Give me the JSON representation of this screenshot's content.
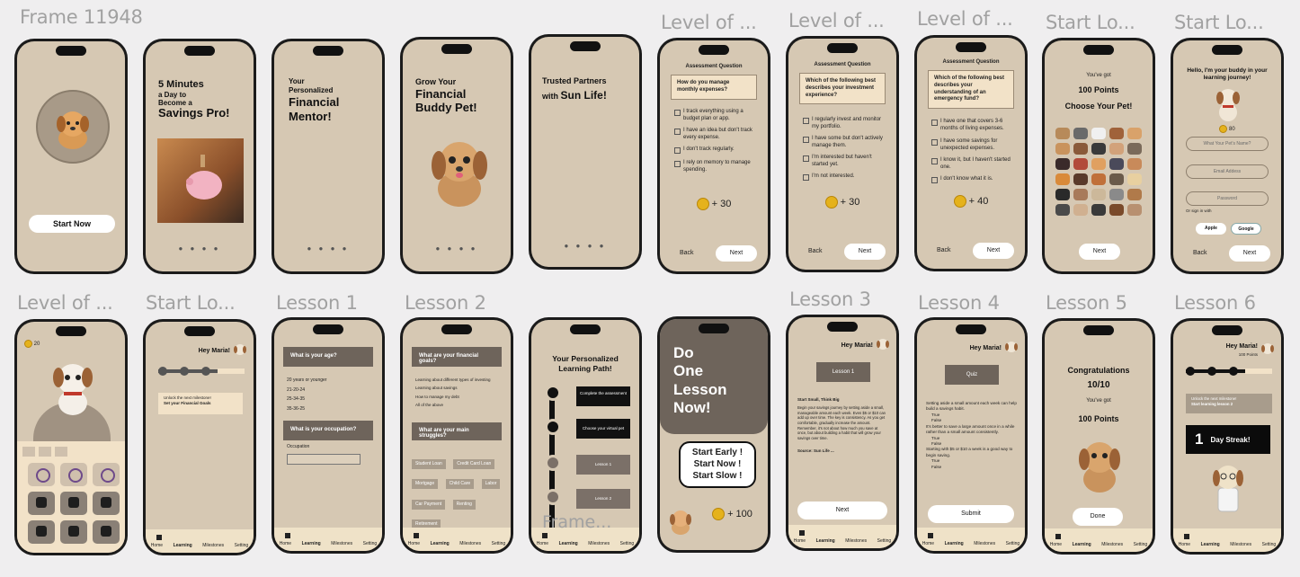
{
  "labels": {
    "f1": "Frame 11948",
    "f6": "Level of ...",
    "f7": "Level of ...",
    "f8": "Level of ...",
    "f9": "Start Lo...",
    "f10": "Start Lo...",
    "b1": "Level of ...",
    "b2": "Start Lo...",
    "b3": "Lesson 1",
    "b4": "Lesson 2",
    "b6": "Lesson 3",
    "b7": "Lesson 4",
    "b8": "Lesson 5",
    "b9": "Lesson 6",
    "frame_overlay": "Frame..."
  },
  "s1": {
    "start_now": "Start Now"
  },
  "s2": {
    "line1": "5 Minutes",
    "line2": "a Day to",
    "line3": "Become a",
    "line4": "Savings Pro!",
    "dots": "● ● ● ●"
  },
  "s3": {
    "line1": "Your",
    "line2": "Personalized",
    "line3": "Financial",
    "line4": "Mentor!",
    "dots": "● ● ● ●"
  },
  "s4": {
    "line1": "Grow Your",
    "line2": "Financial",
    "line3": "Buddy Pet!",
    "dots": "● ● ● ●"
  },
  "s5": {
    "line1": "Trusted Partners",
    "line2a": "with ",
    "line2b": "Sun Life!",
    "dots": "● ● ● ●"
  },
  "s6": {
    "header": "Assessment Question",
    "question": "How do you manage monthly expenses?",
    "options": [
      "I track everything using a budget plan or app.",
      "I have an idea but don't track every expense.",
      "I don't track regularly.",
      "I rely on memory to manage spending."
    ],
    "points": "+ 30",
    "back": "Back",
    "next": "Next"
  },
  "s7": {
    "header": "Assessment Question",
    "question": "Which of the following best describes your investment experience?",
    "options": [
      "I regularly invest and monitor my portfolio.",
      "I have some but don't actively manage them.",
      "I'm interested but haven't started yet.",
      "I'm not interested."
    ],
    "points": "+ 30",
    "back": "Back",
    "next": "Next"
  },
  "s8": {
    "header": "Assessment Question",
    "question": "Which of the following best describes your understanding of an emergency fund?",
    "options": [
      "I have one that covers 3-6 months of living expenses.",
      "I have some savings for unexpected expenses.",
      "I know it, but I haven't started one.",
      "I don't know what it is."
    ],
    "points": "+ 40",
    "back": "Back",
    "next": "Next"
  },
  "s9": {
    "got": "You've got",
    "points": "100 Points",
    "choose": "Choose Your Pet!",
    "next": "Next"
  },
  "s10": {
    "hello": "Hello, I'm your buddy in your learning journey!",
    "coins": "80",
    "pet_name": "What Your Pet's Name?",
    "email": "Email Addess",
    "password": "Password",
    "signin": "Or sign in with",
    "apple": "Apple",
    "google": "Google",
    "back": "Back",
    "next": "Next"
  },
  "b1s": {
    "coins": "20"
  },
  "b2s": {
    "hey": "Hey Maria!",
    "unlock": "Unlock the next milestone!",
    "goal": "Set your Financial Goals"
  },
  "nav": {
    "home": "Home",
    "learning": "Learning",
    "milestones": "Milestones",
    "setting": "Setting"
  },
  "b3s": {
    "q1": "What is your age?",
    "ages": [
      "20 years or younger",
      "21-20-24",
      "25-34-35",
      "35-36-25"
    ],
    "q2": "What is your occupation?",
    "occ_label": "Occupation"
  },
  "b4s": {
    "q1": "What are your financial goals?",
    "goals": [
      "Learning about different types of investing",
      "Learning about savings",
      "How to manage my debt",
      "All of the above"
    ],
    "q2": "What are your main struggles?",
    "tags": [
      "Student Loan",
      "Credit Card Loan",
      "Mortgage",
      "Child Care",
      "Labor",
      "Car Payment",
      "Renting",
      "Retirement"
    ]
  },
  "b5s": {
    "title": "Your Personalized Learning Path!",
    "step1": "Complete the assessment",
    "step2": "Choose your virtual pet",
    "step3": "Lesson 1",
    "step4": "Lesson 2"
  },
  "b6s": {
    "line1": "Do",
    "line2": "One",
    "line3": "Lesson",
    "line4": "Now!",
    "bubble1": "Start Early !",
    "bubble2": "Start Now !",
    "bubble3": "Start Slow !",
    "points": "+ 100"
  },
  "b7s": {
    "hey": "Hey Maria!",
    "lesson": "Lesson 1",
    "heading": "Start Small, Think Big",
    "body": "Begin your savings journey by setting aside a small, manageable amount each week. Even $5 or $10 can add up over time. The key is consistency. As you get comfortable, gradually increase the amount. Remember, it's not about how much you save at once, but about building a habit that will grow your savings over time.",
    "source": "Source: Sun Life ...",
    "next": "Next"
  },
  "b8s": {
    "hey": "Hey Maria!",
    "quiz": "Quiz",
    "q1": "Setting aside a small amount each week can help build a savings habit.",
    "q2": "It's better to save a large amount once in a while rather than a small amount consistently.",
    "q3": "Starting with $5 or $10 a week is a good way to begin saving.",
    "t": "True",
    "f": "False",
    "submit": "Submit"
  },
  "b9s": {
    "congrats": "Congratulations",
    "score": "10/10",
    "got": "You've got",
    "points": "100 Points",
    "done": "Done"
  },
  "b10s": {
    "hey": "Hey Maria!",
    "points": "100 Points",
    "unlock": "Unlock the next milestone!",
    "goal": "Start learning lesson 2",
    "streak_num": "1",
    "streak": "Day Streak!"
  }
}
